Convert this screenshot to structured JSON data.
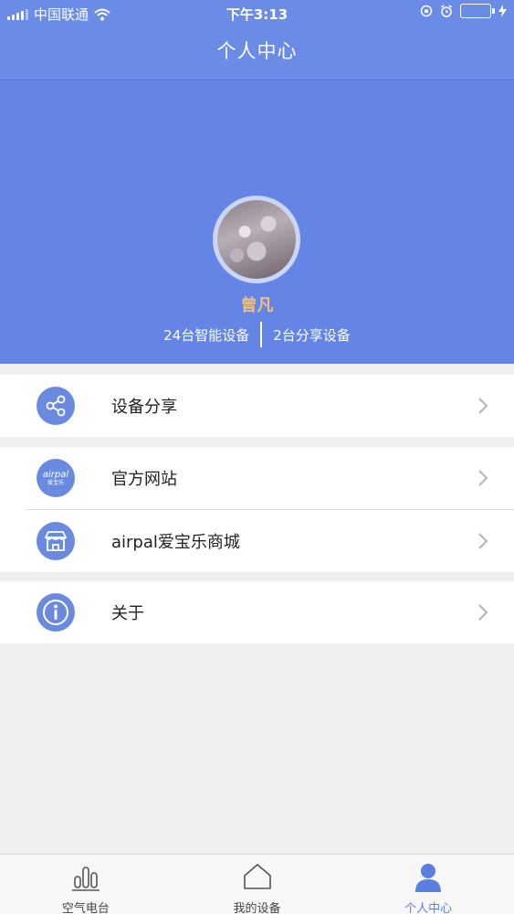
{
  "status_bar": {
    "carrier": "中国联通",
    "time": "下午3:13"
  },
  "header": {
    "title": "个人中心"
  },
  "profile": {
    "name": "曾凡",
    "smart_devices": "24台智能设备",
    "shared_devices": "2台分享设备"
  },
  "menu": {
    "device_share": "设备分享",
    "official_site": "官方网站",
    "airpal_logo_text": "airpal",
    "airpal_logo_sub": "爱宝乐",
    "shop": "airpal爱宝乐商城",
    "about": "关于"
  },
  "tabs": {
    "radio": "空气电台",
    "my_devices": "我的设备",
    "profile": "个人中心"
  },
  "colors": {
    "header_bg": "#6b8ce6",
    "banner_bg": "#6485e6",
    "accent": "#5b7fe0",
    "name": "#f2c079"
  }
}
